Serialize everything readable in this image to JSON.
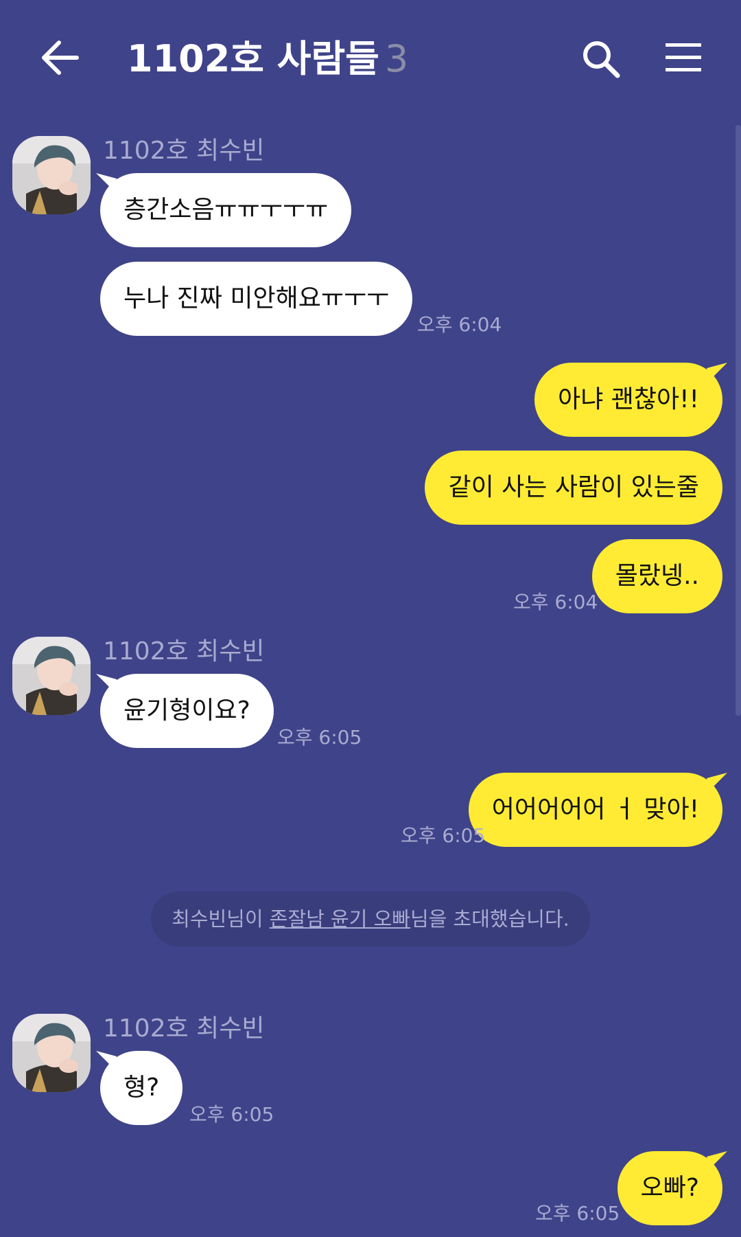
{
  "header": {
    "title": "1102호 사람들",
    "member_count": "3",
    "back_icon": "arrow-left-icon",
    "search_icon": "search-icon",
    "menu_icon": "hamburger-menu-icon"
  },
  "messages": [
    {
      "sender": "1102호 최수빈",
      "text": "층간소음ㅠㅠㅜㅜㅠ",
      "direction": "in"
    },
    {
      "text": "누나 진짜 미안해요ㅠㅜㅜ",
      "direction": "in",
      "time": "오후 6:04"
    },
    {
      "text": "아냐 괜찮아!!",
      "direction": "out"
    },
    {
      "text": "같이 사는 사람이 있는줄",
      "direction": "out"
    },
    {
      "text": "몰랐넹..",
      "direction": "out",
      "time": "오후 6:04"
    },
    {
      "sender": "1102호 최수빈",
      "text": "윤기형이요?",
      "direction": "in",
      "time": "오후 6:05"
    },
    {
      "text": "어어어어어 ㅓ 맞아!",
      "direction": "out",
      "time": "오후 6:05"
    },
    {
      "sender": "1102호 최수빈",
      "text": "형?",
      "direction": "in",
      "time": "오후 6:05"
    },
    {
      "text": "오빠?",
      "direction": "out",
      "time": "오후 6:05"
    }
  ],
  "notice": {
    "prefix": "최수빈님이 ",
    "invitee": "존잘남 윤기 오빠",
    "suffix": "님을 초대했습니다."
  },
  "colors": {
    "background": "#3f4389",
    "incoming_bubble": "#ffffff",
    "outgoing_bubble": "#ffeb33"
  }
}
